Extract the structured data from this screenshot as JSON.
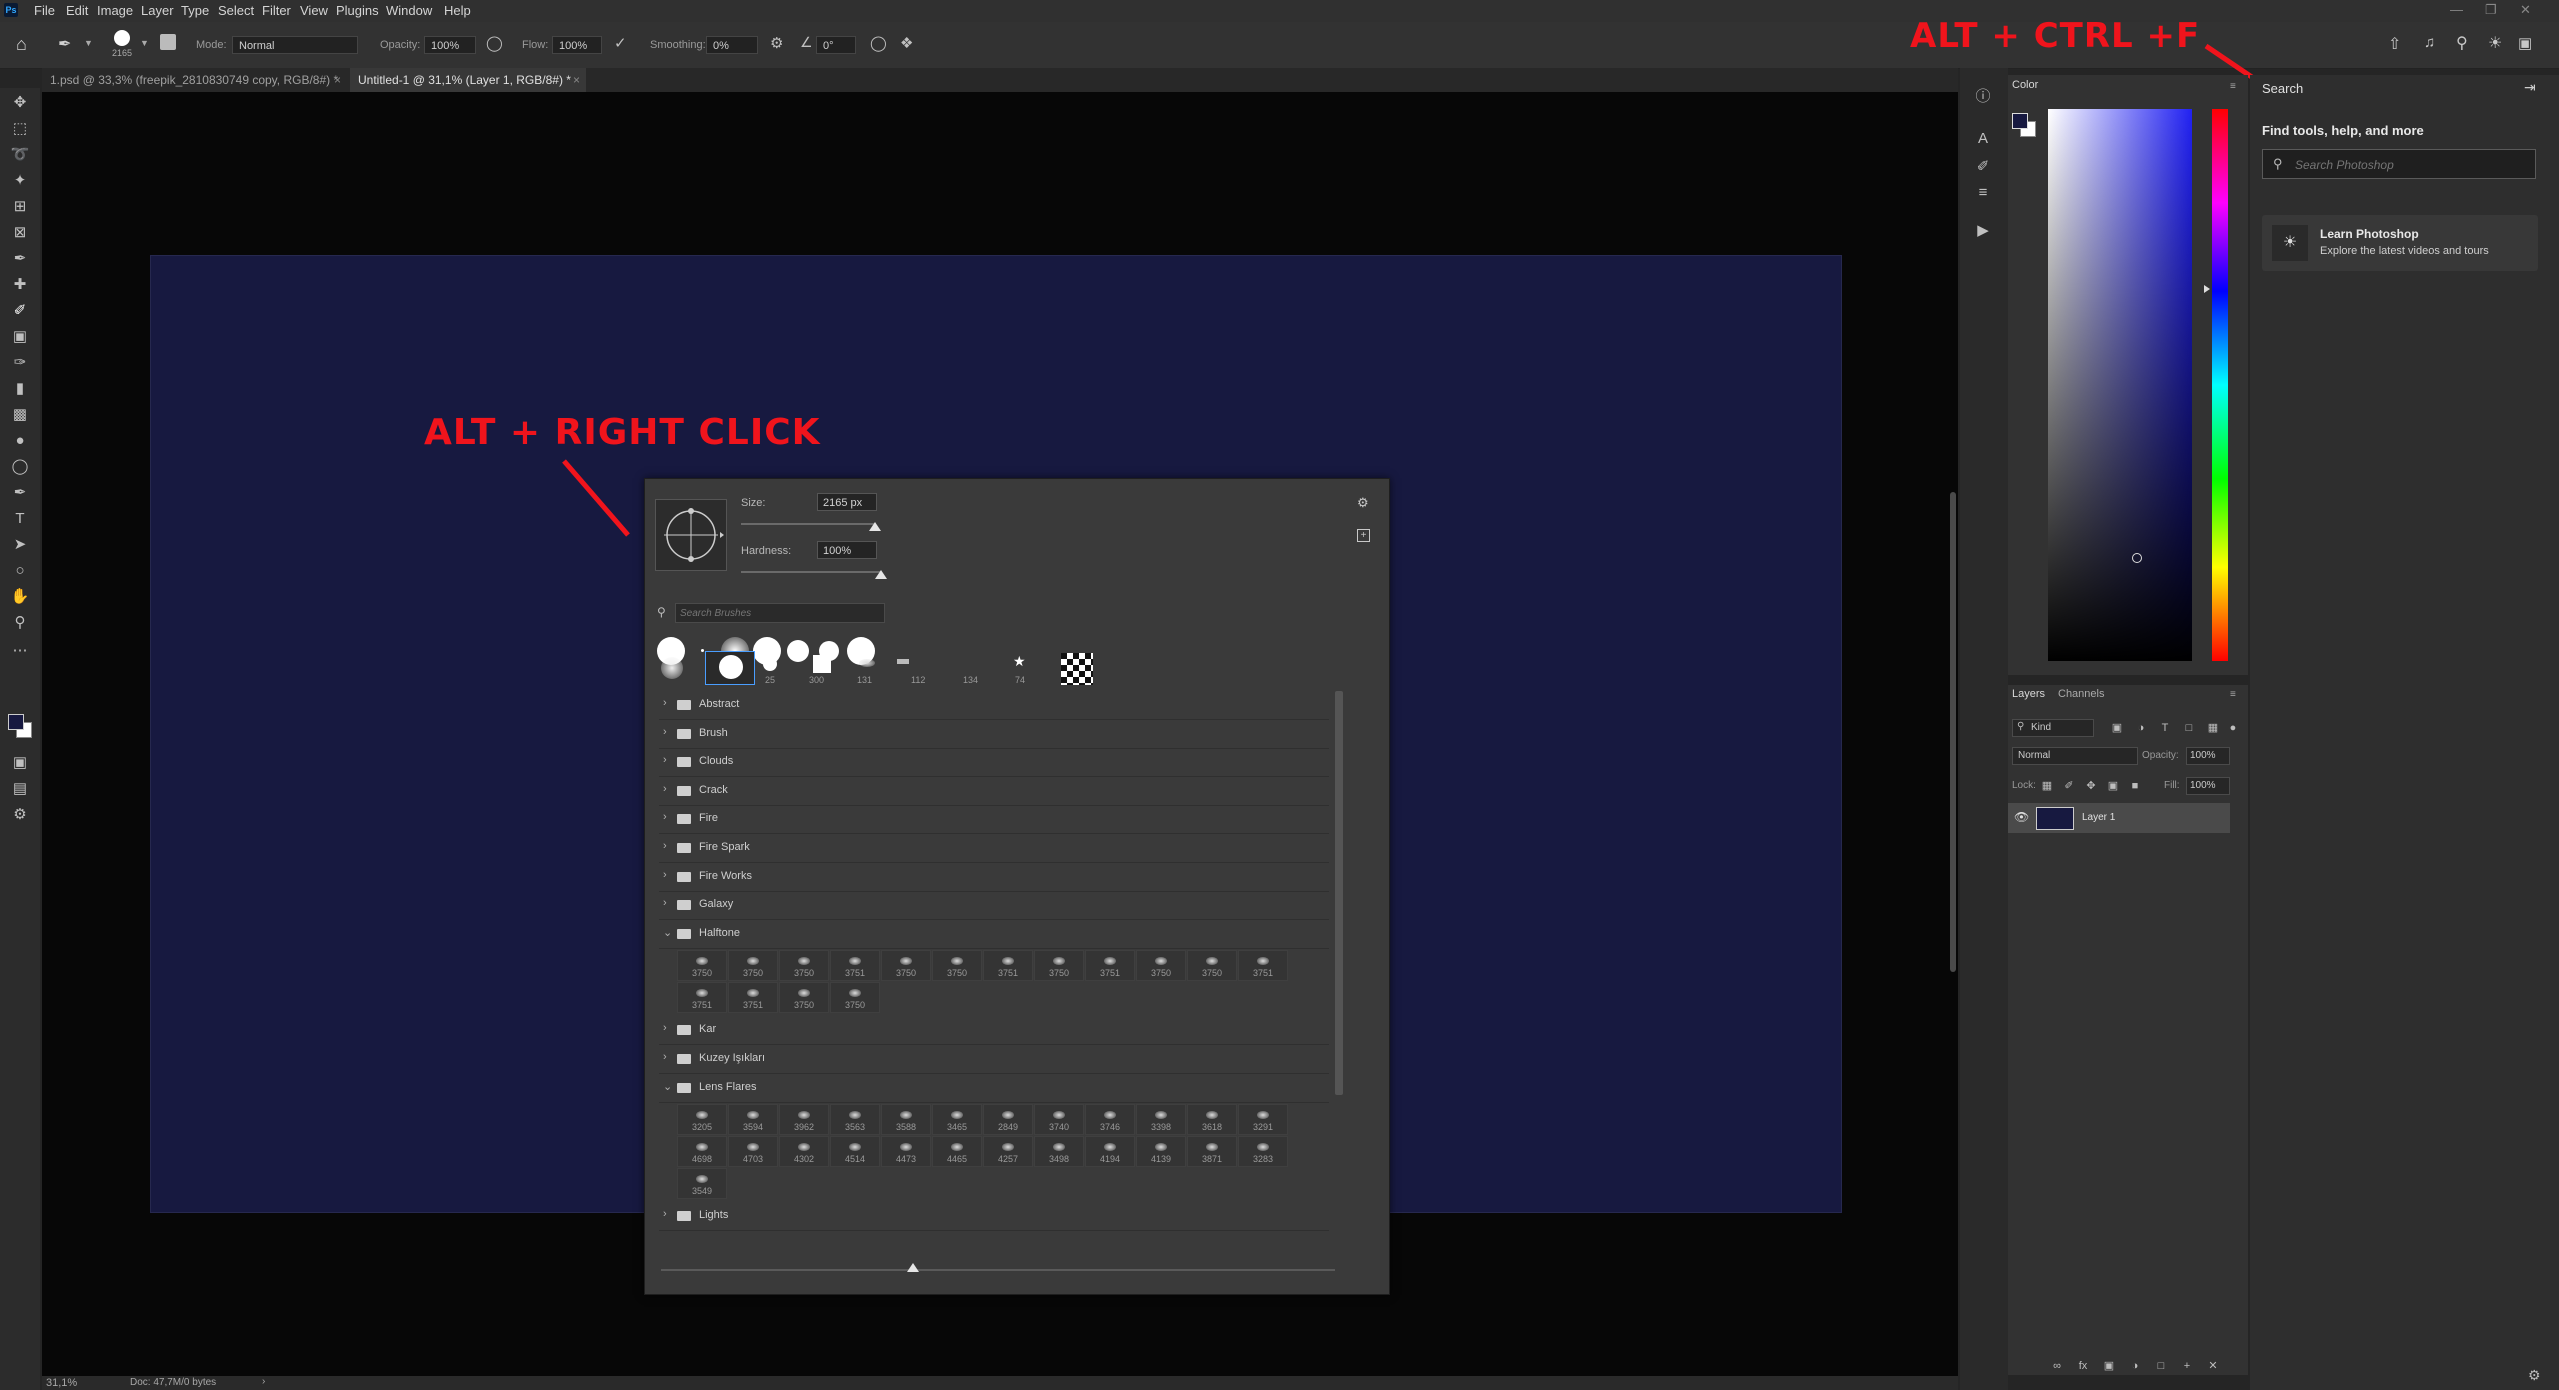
{
  "app": {
    "logo": "Ps"
  },
  "menubar": {
    "items": [
      "File",
      "Edit",
      "Image",
      "Layer",
      "Type",
      "Select",
      "Filter",
      "View",
      "Plugins",
      "Window",
      "Help"
    ]
  },
  "options": {
    "brush_size": "2165",
    "mode_label": "Mode:",
    "mode_value": "Normal",
    "opacity_label": "Opacity:",
    "opacity_value": "100%",
    "flow_label": "Flow:",
    "flow_value": "100%",
    "smoothing_label": "Smoothing:",
    "smoothing_value": "0%",
    "angle_value": "0°"
  },
  "tabs": [
    {
      "label": "1.psd @ 33,3% (freepik_2810830749 copy, RGB/8#) *"
    },
    {
      "label": "Untitled-1 @ 31,1% (Layer 1, RGB/8#) *"
    }
  ],
  "annotations": {
    "alt_right_click": "ALT + RIGHT CLICK",
    "alt_ctrl_f": "ALT + CTRL +F"
  },
  "brush_popup": {
    "size_label": "Size:",
    "size_value": "2165 px",
    "hardness_label": "Hardness:",
    "hardness_value": "100%",
    "search_placeholder": "Search Brushes",
    "size_fraction": 1.0,
    "hardness_fraction": 1.0,
    "recent_sizes": [
      "25",
      "300",
      "131",
      "112",
      "134",
      "74"
    ],
    "folders_top": [
      "Abstract",
      "Brush",
      "Clouds",
      "Crack",
      "Fire",
      "Fire Spark",
      "Fire Works",
      "Galaxy",
      "Halftone"
    ],
    "halftone_nums": [
      "3750",
      "3750",
      "3750",
      "3751",
      "3750",
      "3750",
      "3751",
      "3750",
      "3751",
      "3750",
      "3750",
      "3751",
      "3751",
      "3751",
      "3750",
      "3750"
    ],
    "folders_mid": [
      "Kar",
      "Kuzey Işıkları",
      "Lens Flares"
    ],
    "lensflare_nums": [
      "3205",
      "3594",
      "3962",
      "3563",
      "3588",
      "3465",
      "2849",
      "3740",
      "3746",
      "3398",
      "3618",
      "3291",
      "4698",
      "4703",
      "4302",
      "4514",
      "4473",
      "4465",
      "4257",
      "3498",
      "4194",
      "4139",
      "3871",
      "3283",
      "3549"
    ],
    "folders_bottom": [
      "Lights"
    ]
  },
  "color_panel": {
    "tab": "Color",
    "fg_color": "#171940",
    "bg_color": "#ffffff"
  },
  "layers_panel": {
    "tabs": [
      "Layers",
      "Channels"
    ],
    "filter_kind": "Kind",
    "blend_mode": "Normal",
    "opacity_label": "Opacity:",
    "opacity_value": "100%",
    "lock_label": "Lock:",
    "fill_label": "Fill:",
    "fill_value": "100%",
    "layers": [
      {
        "name": "Layer 1"
      }
    ]
  },
  "search_panel": {
    "title": "Search",
    "heading": "Find tools, help, and more",
    "placeholder": "Search Photoshop",
    "learn_title": "Learn Photoshop",
    "learn_subtitle": "Explore the latest videos and tours"
  },
  "status": {
    "zoom": "31,1%",
    "doc": "Doc: 47,7M/0 bytes"
  }
}
